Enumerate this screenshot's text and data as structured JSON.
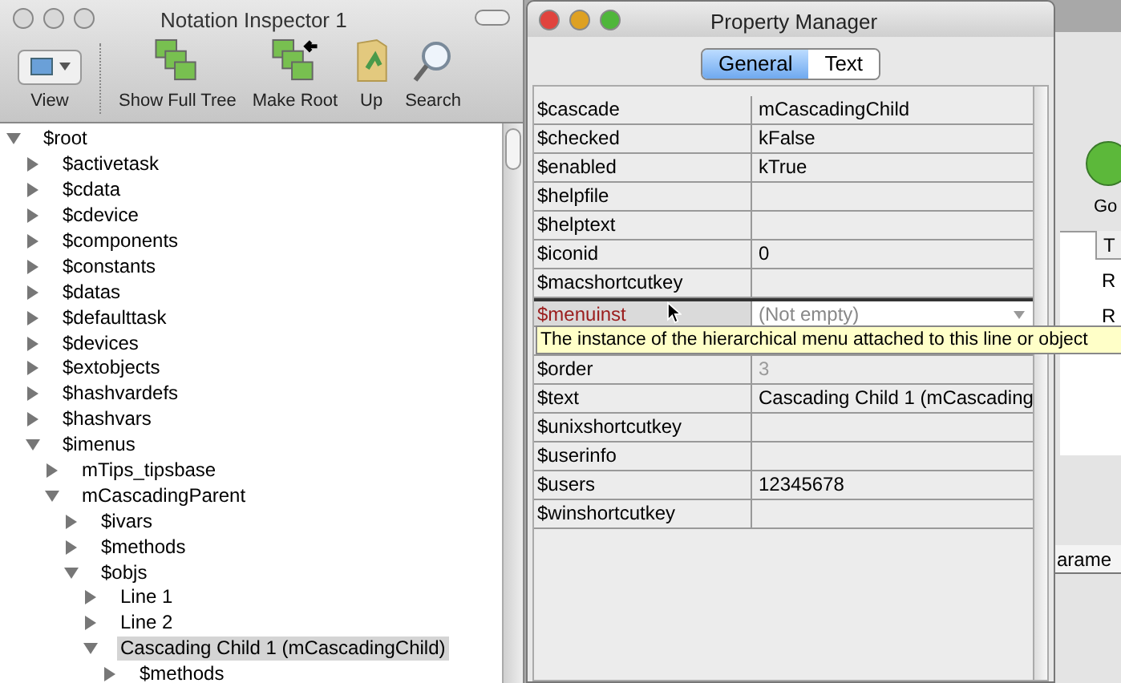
{
  "inspector": {
    "title": "Notation Inspector 1",
    "toolbar": [
      {
        "label": "View",
        "kind": "view"
      },
      {
        "label": "Show Full Tree",
        "kind": "tree"
      },
      {
        "label": "Make Root",
        "kind": "root"
      },
      {
        "label": "Up",
        "kind": "up"
      },
      {
        "label": "Search",
        "kind": "search"
      }
    ],
    "tree": [
      {
        "label": "$root",
        "expanded": true,
        "selected": false,
        "children": [
          {
            "label": "$activetask",
            "expanded": false,
            "selected": false
          },
          {
            "label": "$cdata",
            "expanded": false,
            "selected": false
          },
          {
            "label": "$cdevice",
            "expanded": false,
            "selected": false
          },
          {
            "label": "$components",
            "expanded": false,
            "selected": false
          },
          {
            "label": "$constants",
            "expanded": false,
            "selected": false
          },
          {
            "label": "$datas",
            "expanded": false,
            "selected": false
          },
          {
            "label": "$defaulttask",
            "expanded": false,
            "selected": false
          },
          {
            "label": "$devices",
            "expanded": false,
            "selected": false
          },
          {
            "label": "$extobjects",
            "expanded": false,
            "selected": false
          },
          {
            "label": "$hashvardefs",
            "expanded": false,
            "selected": false
          },
          {
            "label": "$hashvars",
            "expanded": false,
            "selected": false
          },
          {
            "label": "$imenus",
            "expanded": true,
            "selected": false,
            "children": [
              {
                "label": "mTips_tipsbase",
                "expanded": false,
                "selected": false
              },
              {
                "label": "mCascadingParent",
                "expanded": true,
                "selected": false,
                "children": [
                  {
                    "label": "$ivars",
                    "expanded": false,
                    "selected": false
                  },
                  {
                    "label": "$methods",
                    "expanded": false,
                    "selected": false
                  },
                  {
                    "label": "$objs",
                    "expanded": true,
                    "selected": false,
                    "children": [
                      {
                        "label": "Line 1",
                        "expanded": false,
                        "selected": false
                      },
                      {
                        "label": "Line 2",
                        "expanded": false,
                        "selected": false
                      },
                      {
                        "label": "Cascading Child 1 (mCascadingChild)",
                        "expanded": true,
                        "selected": true,
                        "children": [
                          {
                            "label": "$methods",
                            "expanded": false,
                            "selected": false
                          }
                        ]
                      }
                    ]
                  }
                ]
              }
            ]
          }
        ]
      }
    ]
  },
  "property_manager": {
    "title": "Property Manager",
    "tabs": [
      {
        "label": "General",
        "selected": true
      },
      {
        "label": "Text",
        "selected": false
      }
    ],
    "rows": [
      {
        "name": "$cascade",
        "value": "mCascadingChild",
        "kind": "text"
      },
      {
        "name": "$checked",
        "value": "kFalse",
        "kind": "text"
      },
      {
        "name": "$enabled",
        "value": "kTrue",
        "kind": "text"
      },
      {
        "name": "$helpfile",
        "kind": "text"
      },
      {
        "name": "$helptext",
        "kind": "text"
      },
      {
        "name": "$iconid",
        "value": "0",
        "kind": "text"
      },
      {
        "name": "$macshortcutkey",
        "kind": "text"
      },
      {
        "name": "$menuinst",
        "placeholder": "(Not empty)",
        "kind": "dropdown"
      },
      {
        "kind": "hidden"
      },
      {
        "name": "$order",
        "value": "3",
        "kind": "readonly"
      },
      {
        "name": "$text",
        "value": "Cascading Child 1 (mCascading",
        "kind": "text"
      },
      {
        "name": "$unixshortcutkey",
        "kind": "text"
      },
      {
        "name": "$userinfo",
        "kind": "text"
      },
      {
        "name": "$users",
        "value": "12345678",
        "kind": "text"
      },
      {
        "name": "$winshortcutkey",
        "kind": "text"
      }
    ],
    "tooltip": "The instance of the hierarchical menu attached to this line or object"
  },
  "background_window": {
    "button": "Go",
    "column_1": "T",
    "cells": [
      "R",
      "R"
    ],
    "tab": "arame"
  }
}
